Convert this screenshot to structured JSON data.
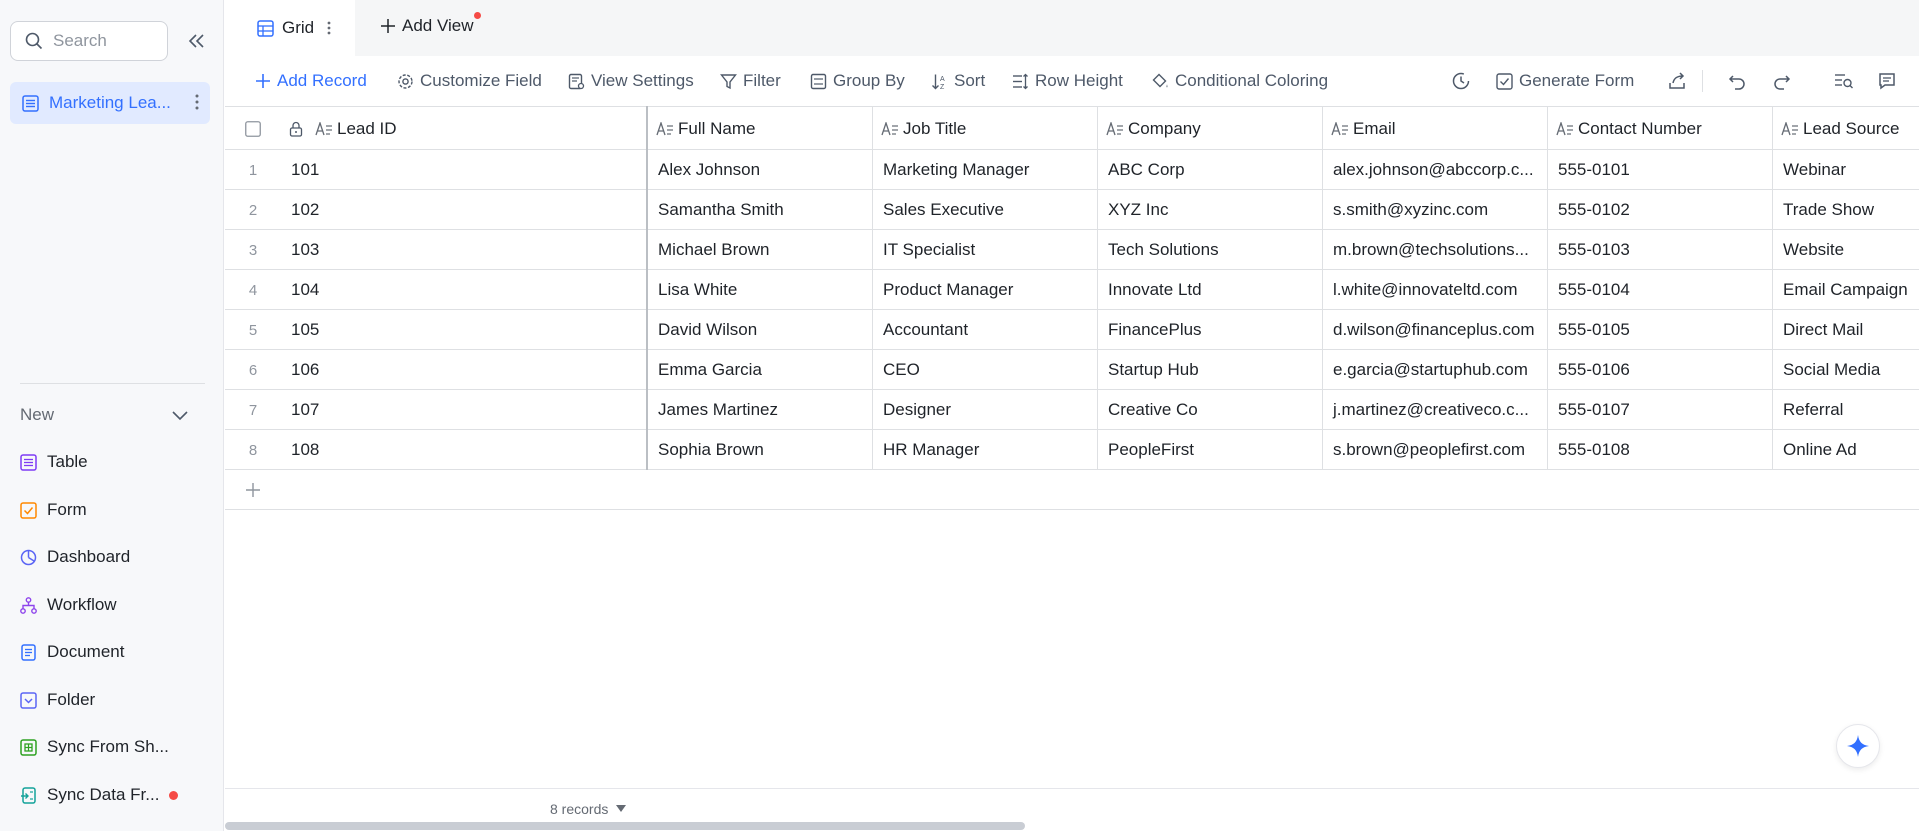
{
  "sidebar": {
    "search_placeholder": "Search",
    "active_item": "Marketing Lea...",
    "new_label": "New",
    "items": [
      {
        "label": "Table",
        "icon": "table-icon"
      },
      {
        "label": "Form",
        "icon": "form-icon"
      },
      {
        "label": "Dashboard",
        "icon": "dashboard-icon"
      },
      {
        "label": "Workflow",
        "icon": "workflow-icon"
      },
      {
        "label": "Document",
        "icon": "document-icon"
      },
      {
        "label": "Folder",
        "icon": "folder-icon"
      },
      {
        "label": "Sync From Sh...",
        "icon": "sync-sheet-icon"
      },
      {
        "label": "Sync Data Fr...",
        "icon": "sync-data-icon"
      }
    ]
  },
  "tabs": {
    "grid_label": "Grid",
    "add_view_label": "Add View"
  },
  "toolbar": {
    "add_record": "Add Record",
    "customize_field": "Customize Field",
    "view_settings": "View Settings",
    "filter": "Filter",
    "group_by": "Group By",
    "sort": "Sort",
    "row_height": "Row Height",
    "conditional_coloring": "Conditional Coloring",
    "generate_form": "Generate Form"
  },
  "table": {
    "columns": [
      "Lead ID",
      "Full Name",
      "Job Title",
      "Company",
      "Email",
      "Contact Number",
      "Lead Source"
    ],
    "rows": [
      {
        "n": "1",
        "cells": [
          "101",
          "Alex Johnson",
          "Marketing Manager",
          "ABC Corp",
          "alex.johnson@abccorp.c...",
          "555-0101",
          "Webinar"
        ]
      },
      {
        "n": "2",
        "cells": [
          "102",
          "Samantha Smith",
          "Sales Executive",
          "XYZ Inc",
          "s.smith@xyzinc.com",
          "555-0102",
          "Trade Show"
        ]
      },
      {
        "n": "3",
        "cells": [
          "103",
          "Michael Brown",
          "IT Specialist",
          "Tech Solutions",
          "m.brown@techsolutions...",
          "555-0103",
          "Website"
        ]
      },
      {
        "n": "4",
        "cells": [
          "104",
          "Lisa White",
          "Product Manager",
          "Innovate Ltd",
          "l.white@innovateltd.com",
          "555-0104",
          "Email Campaign"
        ]
      },
      {
        "n": "5",
        "cells": [
          "105",
          "David Wilson",
          "Accountant",
          "FinancePlus",
          "d.wilson@financeplus.com",
          "555-0105",
          "Direct Mail"
        ]
      },
      {
        "n": "6",
        "cells": [
          "106",
          "Emma Garcia",
          "CEO",
          "Startup Hub",
          "e.garcia@startuphub.com",
          "555-0106",
          "Social Media"
        ]
      },
      {
        "n": "7",
        "cells": [
          "107",
          "James Martinez",
          "Designer",
          "Creative Co",
          "j.martinez@creativeco.c...",
          "555-0107",
          "Referral"
        ]
      },
      {
        "n": "8",
        "cells": [
          "108",
          "Sophia Brown",
          "HR Manager",
          "PeopleFirst",
          "s.brown@peoplefirst.com",
          "555-0108",
          "Online Ad"
        ]
      }
    ]
  },
  "footer": {
    "records": "8 records"
  },
  "colors": {
    "accent": "#3370ff",
    "notification": "#f54a45"
  }
}
